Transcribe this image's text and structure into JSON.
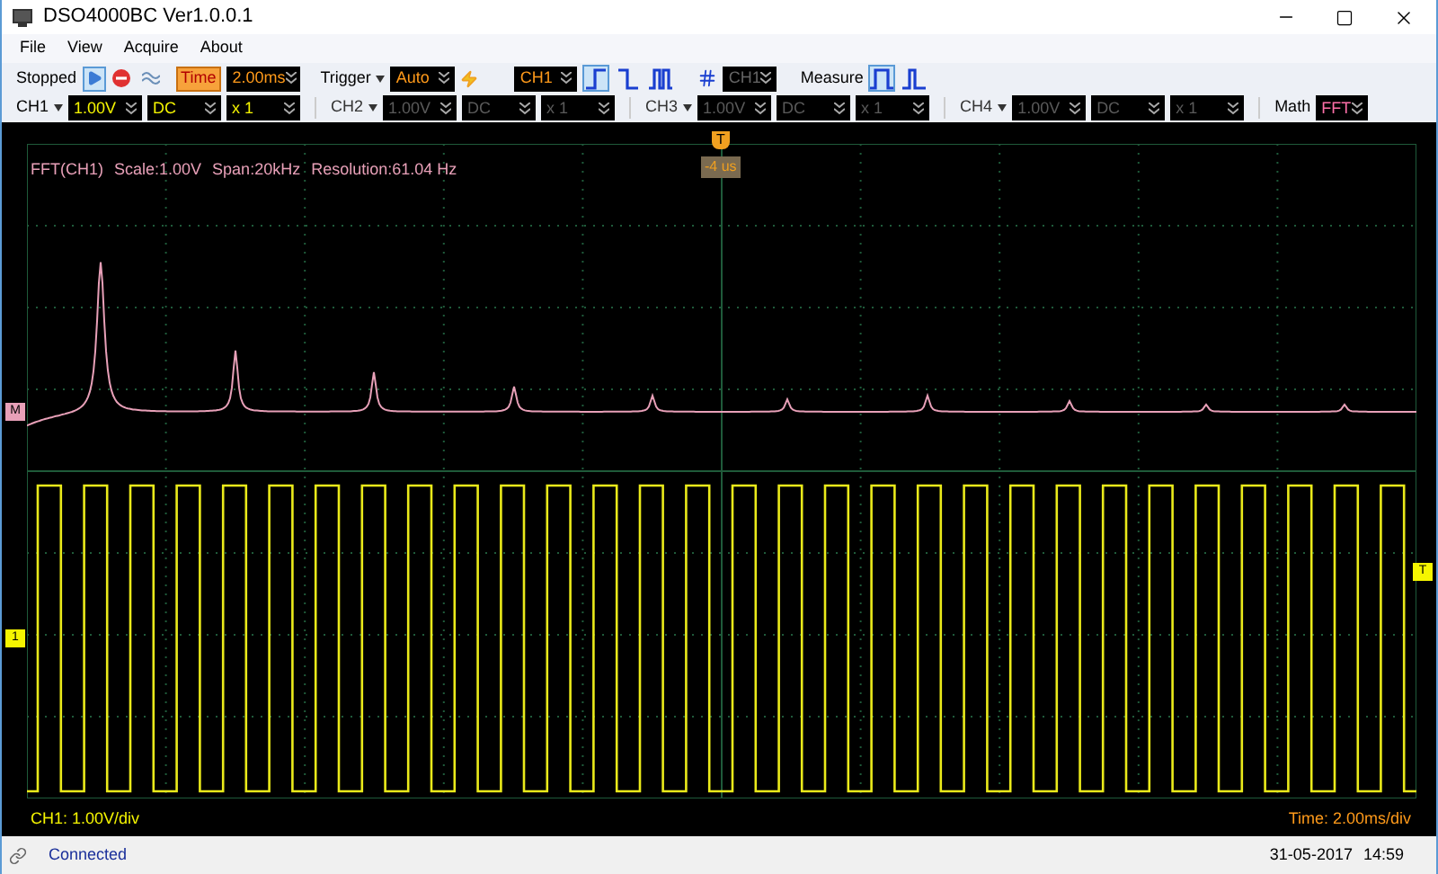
{
  "window": {
    "title": "DSO4000BC Ver1.0.0.1"
  },
  "menu": [
    {
      "label": "File"
    },
    {
      "label": "View"
    },
    {
      "label": "Acquire"
    },
    {
      "label": "About"
    }
  ],
  "toolbar": {
    "state": "Stopped",
    "run_selected": true,
    "time_label": "Time",
    "time_value": "2.00ms",
    "trigger_label": "Trigger",
    "trigger_mode": "Auto",
    "trigger_source": "CH1",
    "edges": [
      {
        "kind": "rising",
        "selected": true
      },
      {
        "kind": "falling",
        "selected": false
      },
      {
        "kind": "pulse",
        "selected": false
      }
    ],
    "cursor_source": "CH1",
    "measure_label": "Measure",
    "measure_modes": [
      {
        "kind": "wide",
        "selected": true
      },
      {
        "kind": "narrow",
        "selected": false
      }
    ]
  },
  "channels": [
    {
      "name": "CH1",
      "scale": "1.00V",
      "coupling": "DC",
      "probe": "x 1",
      "enabled": true
    },
    {
      "name": "CH2",
      "scale": "1.00V",
      "coupling": "DC",
      "probe": "x 1",
      "enabled": false
    },
    {
      "name": "CH3",
      "scale": "1.00V",
      "coupling": "DC",
      "probe": "x 1",
      "enabled": false
    },
    {
      "name": "CH4",
      "scale": "1.00V",
      "coupling": "DC",
      "probe": "x 1",
      "enabled": false
    }
  ],
  "math": {
    "label": "Math",
    "mode": "FFT"
  },
  "scope": {
    "fft_info": [
      "FFT(CH1)",
      "Scale:1.00V",
      "Span:20kHz",
      "Resolution:61.04 Hz"
    ],
    "trigger_offset": "-4 us",
    "math_marker": "M",
    "channel_marker": "1",
    "trigger_marker": "T",
    "trigger_level_marker": "T",
    "channel_scale": "CH1: 1.00V/div",
    "time_scale": "Time: 2.00ms/div"
  },
  "status_bar": {
    "connection": "Connected",
    "date": "31-05-2017",
    "time": "14:59"
  }
}
